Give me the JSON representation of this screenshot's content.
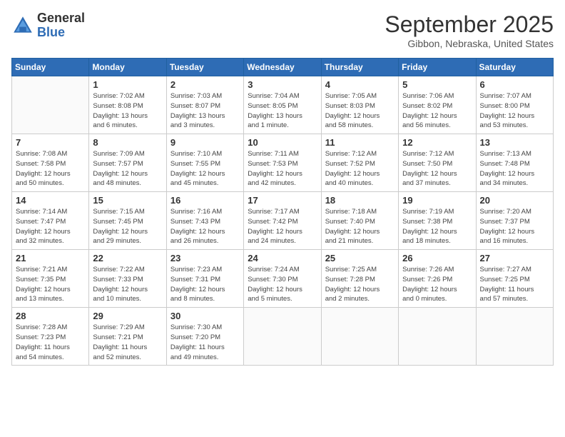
{
  "logo": {
    "general": "General",
    "blue": "Blue"
  },
  "header": {
    "month": "September 2025",
    "location": "Gibbon, Nebraska, United States"
  },
  "days_of_week": [
    "Sunday",
    "Monday",
    "Tuesday",
    "Wednesday",
    "Thursday",
    "Friday",
    "Saturday"
  ],
  "weeks": [
    [
      {
        "day": "",
        "info": ""
      },
      {
        "day": "1",
        "info": "Sunrise: 7:02 AM\nSunset: 8:08 PM\nDaylight: 13 hours\nand 6 minutes."
      },
      {
        "day": "2",
        "info": "Sunrise: 7:03 AM\nSunset: 8:07 PM\nDaylight: 13 hours\nand 3 minutes."
      },
      {
        "day": "3",
        "info": "Sunrise: 7:04 AM\nSunset: 8:05 PM\nDaylight: 13 hours\nand 1 minute."
      },
      {
        "day": "4",
        "info": "Sunrise: 7:05 AM\nSunset: 8:03 PM\nDaylight: 12 hours\nand 58 minutes."
      },
      {
        "day": "5",
        "info": "Sunrise: 7:06 AM\nSunset: 8:02 PM\nDaylight: 12 hours\nand 56 minutes."
      },
      {
        "day": "6",
        "info": "Sunrise: 7:07 AM\nSunset: 8:00 PM\nDaylight: 12 hours\nand 53 minutes."
      }
    ],
    [
      {
        "day": "7",
        "info": "Sunrise: 7:08 AM\nSunset: 7:58 PM\nDaylight: 12 hours\nand 50 minutes."
      },
      {
        "day": "8",
        "info": "Sunrise: 7:09 AM\nSunset: 7:57 PM\nDaylight: 12 hours\nand 48 minutes."
      },
      {
        "day": "9",
        "info": "Sunrise: 7:10 AM\nSunset: 7:55 PM\nDaylight: 12 hours\nand 45 minutes."
      },
      {
        "day": "10",
        "info": "Sunrise: 7:11 AM\nSunset: 7:53 PM\nDaylight: 12 hours\nand 42 minutes."
      },
      {
        "day": "11",
        "info": "Sunrise: 7:12 AM\nSunset: 7:52 PM\nDaylight: 12 hours\nand 40 minutes."
      },
      {
        "day": "12",
        "info": "Sunrise: 7:12 AM\nSunset: 7:50 PM\nDaylight: 12 hours\nand 37 minutes."
      },
      {
        "day": "13",
        "info": "Sunrise: 7:13 AM\nSunset: 7:48 PM\nDaylight: 12 hours\nand 34 minutes."
      }
    ],
    [
      {
        "day": "14",
        "info": "Sunrise: 7:14 AM\nSunset: 7:47 PM\nDaylight: 12 hours\nand 32 minutes."
      },
      {
        "day": "15",
        "info": "Sunrise: 7:15 AM\nSunset: 7:45 PM\nDaylight: 12 hours\nand 29 minutes."
      },
      {
        "day": "16",
        "info": "Sunrise: 7:16 AM\nSunset: 7:43 PM\nDaylight: 12 hours\nand 26 minutes."
      },
      {
        "day": "17",
        "info": "Sunrise: 7:17 AM\nSunset: 7:42 PM\nDaylight: 12 hours\nand 24 minutes."
      },
      {
        "day": "18",
        "info": "Sunrise: 7:18 AM\nSunset: 7:40 PM\nDaylight: 12 hours\nand 21 minutes."
      },
      {
        "day": "19",
        "info": "Sunrise: 7:19 AM\nSunset: 7:38 PM\nDaylight: 12 hours\nand 18 minutes."
      },
      {
        "day": "20",
        "info": "Sunrise: 7:20 AM\nSunset: 7:37 PM\nDaylight: 12 hours\nand 16 minutes."
      }
    ],
    [
      {
        "day": "21",
        "info": "Sunrise: 7:21 AM\nSunset: 7:35 PM\nDaylight: 12 hours\nand 13 minutes."
      },
      {
        "day": "22",
        "info": "Sunrise: 7:22 AM\nSunset: 7:33 PM\nDaylight: 12 hours\nand 10 minutes."
      },
      {
        "day": "23",
        "info": "Sunrise: 7:23 AM\nSunset: 7:31 PM\nDaylight: 12 hours\nand 8 minutes."
      },
      {
        "day": "24",
        "info": "Sunrise: 7:24 AM\nSunset: 7:30 PM\nDaylight: 12 hours\nand 5 minutes."
      },
      {
        "day": "25",
        "info": "Sunrise: 7:25 AM\nSunset: 7:28 PM\nDaylight: 12 hours\nand 2 minutes."
      },
      {
        "day": "26",
        "info": "Sunrise: 7:26 AM\nSunset: 7:26 PM\nDaylight: 12 hours\nand 0 minutes."
      },
      {
        "day": "27",
        "info": "Sunrise: 7:27 AM\nSunset: 7:25 PM\nDaylight: 11 hours\nand 57 minutes."
      }
    ],
    [
      {
        "day": "28",
        "info": "Sunrise: 7:28 AM\nSunset: 7:23 PM\nDaylight: 11 hours\nand 54 minutes."
      },
      {
        "day": "29",
        "info": "Sunrise: 7:29 AM\nSunset: 7:21 PM\nDaylight: 11 hours\nand 52 minutes."
      },
      {
        "day": "30",
        "info": "Sunrise: 7:30 AM\nSunset: 7:20 PM\nDaylight: 11 hours\nand 49 minutes."
      },
      {
        "day": "",
        "info": ""
      },
      {
        "day": "",
        "info": ""
      },
      {
        "day": "",
        "info": ""
      },
      {
        "day": "",
        "info": ""
      }
    ]
  ]
}
